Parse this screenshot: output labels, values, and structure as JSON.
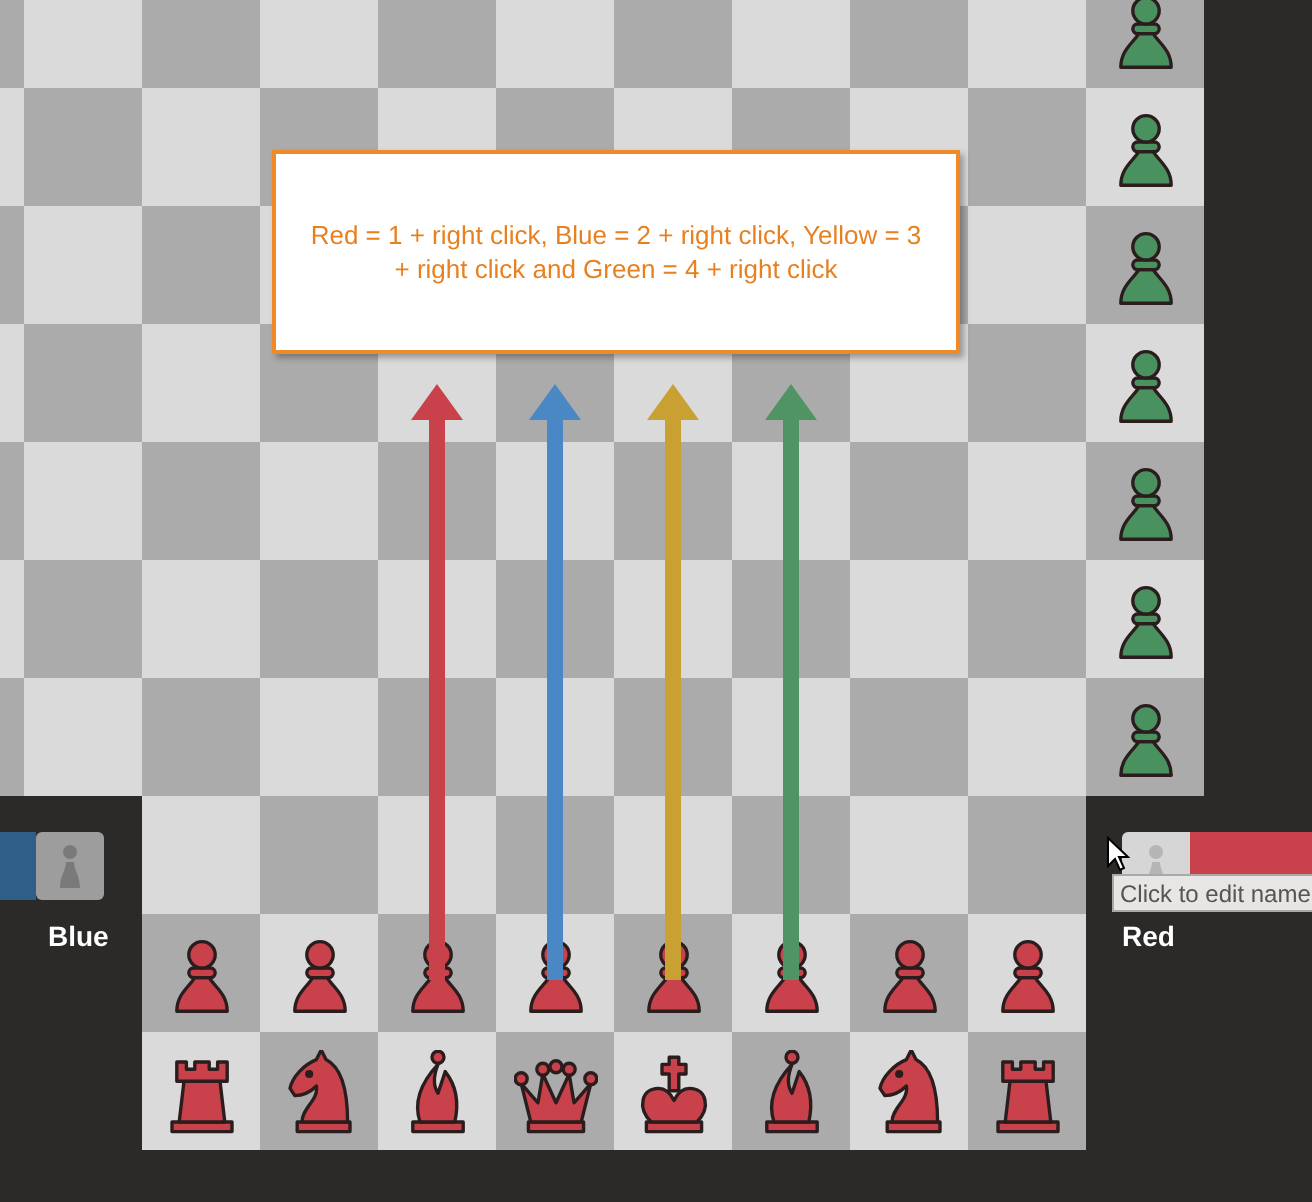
{
  "instruction": "Red = 1 + right click, Blue = 2 + right click, Yellow = 3 + right click and Green = 4 + right click",
  "arrows": [
    {
      "color": "#c8414b"
    },
    {
      "color": "#4a87c5"
    },
    {
      "color": "#c9a133"
    },
    {
      "color": "#4f9462"
    }
  ],
  "armies": [
    {
      "color": "#c8414b",
      "ranks": [
        [
          {
            "kind": "pawn"
          },
          {
            "kind": "pawn"
          },
          {
            "kind": "pawn"
          },
          {
            "kind": "pawn"
          },
          {
            "kind": "pawn"
          },
          {
            "kind": "pawn"
          },
          {
            "kind": "pawn"
          },
          {
            "kind": "pawn"
          }
        ],
        [
          {
            "kind": "rook"
          },
          {
            "kind": "knight"
          },
          {
            "kind": "bishop"
          },
          {
            "kind": "queen"
          },
          {
            "kind": "king"
          },
          {
            "kind": "bishop"
          },
          {
            "kind": "knight"
          },
          {
            "kind": "rook"
          }
        ]
      ]
    },
    {
      "color": "#4a9160",
      "ranks": [
        [
          {
            "kind": "pawn"
          },
          {
            "kind": "pawn"
          },
          {
            "kind": "pawn"
          },
          {
            "kind": "pawn"
          },
          {
            "kind": "pawn"
          },
          {
            "kind": "pawn"
          },
          {
            "kind": "pawn"
          }
        ]
      ]
    }
  ],
  "players": [
    {
      "name": "Blue",
      "color": "#2f5f88"
    },
    {
      "name": "Red",
      "color": "#c8414b",
      "tooltip": "Click to edit name"
    }
  ]
}
